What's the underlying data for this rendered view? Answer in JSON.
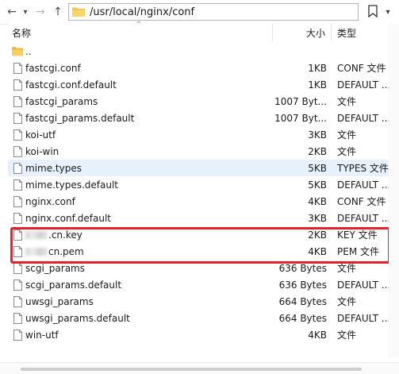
{
  "toolbar": {
    "back_icon": "←",
    "back_dropdown_icon": "▾",
    "forward_icon": "→",
    "up_icon": "↑",
    "path": "/usr/local/nginx/conf",
    "bookmark_icon": "bookmark-add-icon",
    "bookmark_dropdown_icon": "▾"
  },
  "header": {
    "name": "名称",
    "size": "大小",
    "type": "类型",
    "sort_indicator": "^"
  },
  "files": [
    {
      "name": "..",
      "size": "",
      "type": "",
      "icon": "folder-icon"
    },
    {
      "name": "fastcgi.conf",
      "size": "1KB",
      "type": "CONF 文件",
      "icon": "file-icon"
    },
    {
      "name": "fastcgi.conf.default",
      "size": "1KB",
      "type": "DEFAULT ...",
      "icon": "file-icon"
    },
    {
      "name": "fastcgi_params",
      "size": "1007 Byt...",
      "type": "文件",
      "icon": "file-icon"
    },
    {
      "name": "fastcgi_params.default",
      "size": "1007 Byt...",
      "type": "DEFAULT ...",
      "icon": "file-icon"
    },
    {
      "name": "koi-utf",
      "size": "3KB",
      "type": "文件",
      "icon": "file-icon"
    },
    {
      "name": "koi-win",
      "size": "2KB",
      "type": "文件",
      "icon": "file-icon"
    },
    {
      "name": "mime.types",
      "size": "5KB",
      "type": "TYPES 文件",
      "icon": "file-icon",
      "selected": true
    },
    {
      "name": "mime.types.default",
      "size": "5KB",
      "type": "DEFAULT ...",
      "icon": "file-icon"
    },
    {
      "name": "nginx.conf",
      "size": "4KB",
      "type": "CONF 文件",
      "icon": "file-icon"
    },
    {
      "name": "nginx.conf.default",
      "size": "3KB",
      "type": "DEFAULT ...",
      "icon": "file-icon"
    },
    {
      "name": "cn.key",
      "size": "2KB",
      "type": "KEY 文件",
      "icon": "file-icon",
      "blurred_prefix": true,
      "name_prefix_dot": true
    },
    {
      "name": "cn.pem",
      "size": "4KB",
      "type": "PEM 文件",
      "icon": "file-icon",
      "blurred_prefix": true
    },
    {
      "name": "scgi_params",
      "size": "636 Bytes",
      "type": "文件",
      "icon": "file-icon"
    },
    {
      "name": "scgi_params.default",
      "size": "636 Bytes",
      "type": "DEFAULT ...",
      "icon": "file-icon"
    },
    {
      "name": "uwsgi_params",
      "size": "664 Bytes",
      "type": "文件",
      "icon": "file-icon"
    },
    {
      "name": "uwsgi_params.default",
      "size": "664 Bytes",
      "type": "DEFAULT ...",
      "icon": "file-icon"
    },
    {
      "name": "win-utf",
      "size": "4KB",
      "type": "文件",
      "icon": "file-icon"
    }
  ],
  "colors": {
    "highlight": "#e8202a",
    "selected_row": "#e7f1fb",
    "folder": "#f3c44b"
  }
}
